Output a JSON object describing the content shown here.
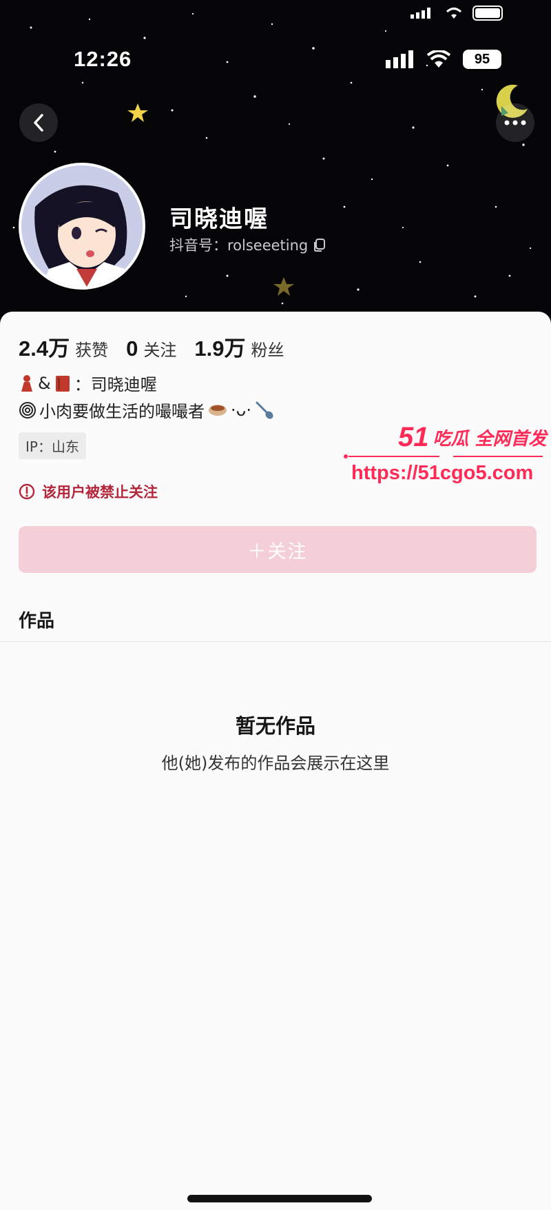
{
  "status_bar": {
    "time": "12:26",
    "battery": "95"
  },
  "profile": {
    "nickname": "司晓迪喔",
    "douyin_id": "抖音号：rolseeeting"
  },
  "stats": [
    {
      "value": "2.4万",
      "label": "获赞"
    },
    {
      "value": "0",
      "label": "关注"
    },
    {
      "value": "1.9万",
      "label": "粉丝"
    }
  ],
  "bio": {
    "line1_amp": "&",
    "line1_text": "：司晓迪喔",
    "line2_text": "小肉要做生活的嘬嘬者",
    "line2_face": "·ᴗ·"
  },
  "ip_label": "IP：山东",
  "banned_notice": "该用户被禁止关注",
  "follow_button": "＋关注",
  "tabs": {
    "works": "作品"
  },
  "empty_state": {
    "title": "暂无作品",
    "subtitle": "他(她)发布的作品会展示在这里"
  },
  "watermark": {
    "brand_number": "51",
    "brand_text": "吃瓜 全网首发",
    "url": "https://51cgo5.com"
  },
  "colors": {
    "header_bg": "#050508",
    "follow_button_bg": "#f5cfd7",
    "banned_text": "#b3263a",
    "watermark": "#ff2a55"
  },
  "icons": [
    "back-icon",
    "more-icon",
    "copy-icon",
    "warning-icon",
    "signal-icon",
    "wifi-icon",
    "moon-icon",
    "star-icon"
  ]
}
